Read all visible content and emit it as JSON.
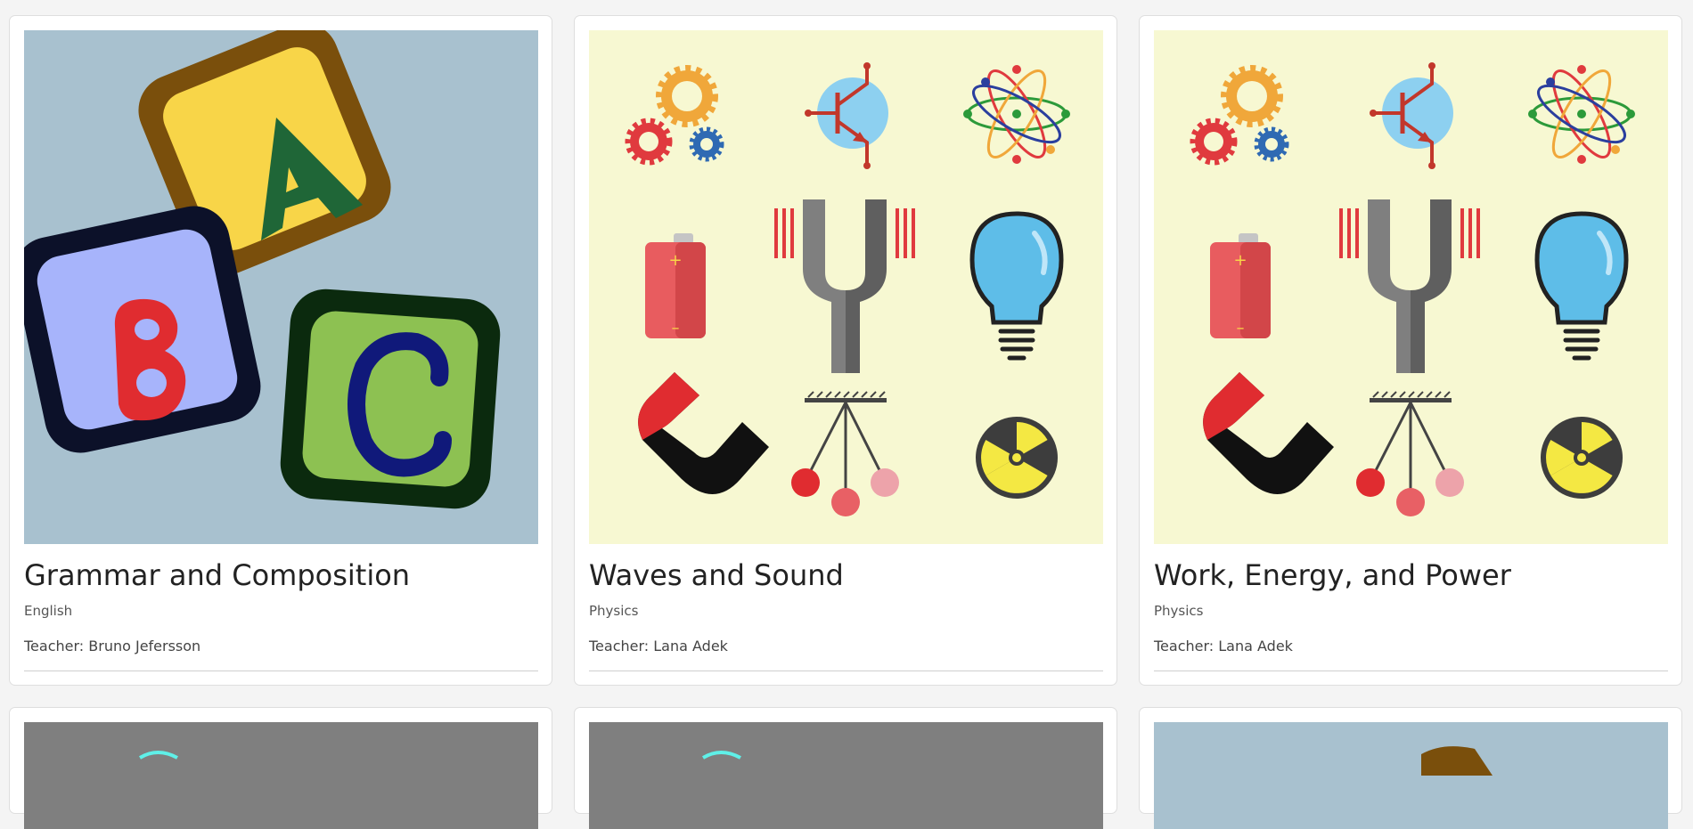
{
  "cards": [
    {
      "title": "Grammar and Composition",
      "subject": "English",
      "teacher_prefix": "Teacher:",
      "teacher_name": "Bruno Jefersson",
      "image": "abc-blocks-image",
      "image_bg": "#a8c1cf"
    },
    {
      "title": "Waves and Sound",
      "subject": "Physics",
      "teacher_prefix": "Teacher:",
      "teacher_name": "Lana Adek",
      "image": "physics-icons-image",
      "image_bg": "#f7f8d2"
    },
    {
      "title": "Work, Energy, and Power",
      "subject": "Physics",
      "teacher_prefix": "Teacher:",
      "teacher_name": "Lana Adek",
      "image": "physics-icons-image",
      "image_bg": "#f7f8d2"
    }
  ],
  "row2_cards": [
    {
      "image": "gray-thumbnail",
      "image_bg": "#7f7f7f"
    },
    {
      "image": "gray-thumbnail",
      "image_bg": "#7f7f7f"
    },
    {
      "image": "abc-blocks-image",
      "image_bg": "#a8c1cf"
    }
  ]
}
